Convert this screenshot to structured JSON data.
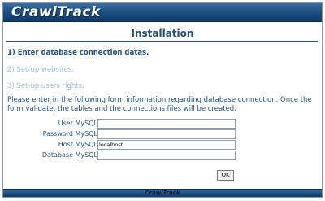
{
  "header": {
    "logo_text": "CrawlTrack"
  },
  "title": "Installation",
  "steps": [
    {
      "label": "1) Enter database connection datas.",
      "active": true
    },
    {
      "label": "2) Set-up websites.",
      "active": false
    },
    {
      "label": "3) Set-up users rights.",
      "active": false
    }
  ],
  "intro": "Please enter in the following form information regarding database connection. Once the form validate, the tables and the connections files will be created.",
  "form": {
    "user": {
      "label": "User MySQL",
      "value": ""
    },
    "password": {
      "label": "Password MySQL",
      "value": ""
    },
    "host": {
      "label": "Host MySQL",
      "value": "localhost"
    },
    "database": {
      "label": "Database MySQL",
      "value": ""
    },
    "submit_label": "OK"
  },
  "footer": {
    "logo_text": "CrawlTrack"
  }
}
